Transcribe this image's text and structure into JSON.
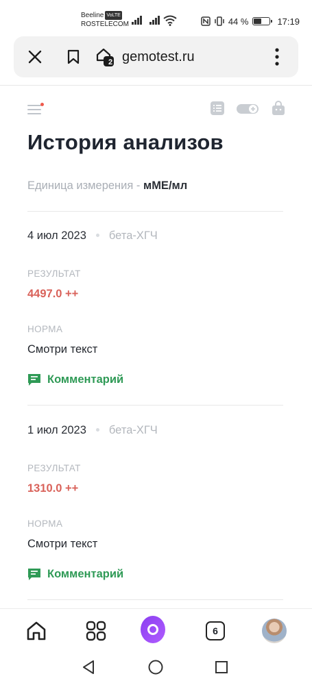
{
  "status_bar": {
    "carrier_1": "Beeline",
    "volte": "VoLTE",
    "carrier_2": "ROSTELECOM",
    "battery": "44 %",
    "time": "17:19"
  },
  "browser": {
    "tab_count_small": "2",
    "domain": "gemotest.ru"
  },
  "page": {
    "title": "История анализов",
    "unit_label": "Единица измерения - ",
    "unit_value": "мМЕ/мл"
  },
  "entries": [
    {
      "date": "4 июл 2023",
      "analyte": "бета-ХГЧ",
      "result_label": "РЕЗУЛЬТАТ",
      "result_value": "4497.0 ++",
      "norm_label": "НОРМА",
      "norm_value": "Смотри текст",
      "comment_label": "Комментарий"
    },
    {
      "date": "1 июл 2023",
      "analyte": "бета-ХГЧ",
      "result_label": "РЕЗУЛЬТАТ",
      "result_value": "1310.0 ++",
      "norm_label": "НОРМА",
      "norm_value": "Смотри текст",
      "comment_label": "Комментарий"
    }
  ],
  "bottom_nav": {
    "tabs_count": "6"
  },
  "colors": {
    "accent_result": "#d9625a",
    "accent_comment": "#2f9a56",
    "alice": "#9b4dff"
  }
}
